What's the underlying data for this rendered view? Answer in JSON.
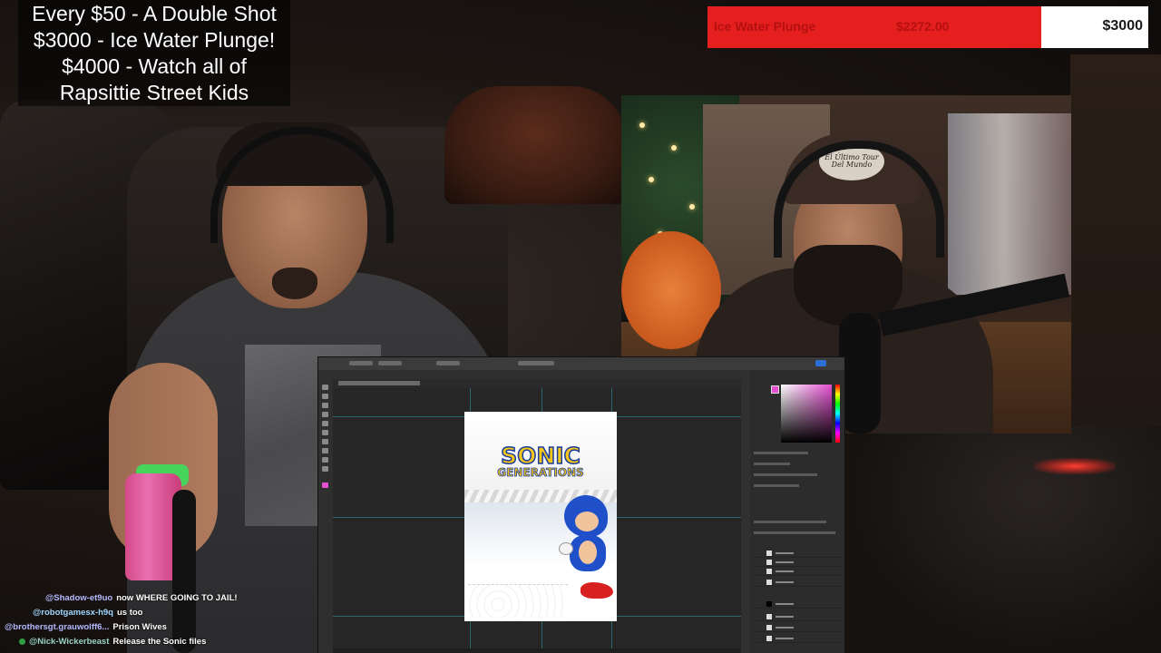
{
  "overlay": {
    "goals": [
      "Every $50 - A Double Shot",
      "$3000 - Ice Water Plunge!",
      "$4000 - Watch all of",
      "Rapsittie Street Kids"
    ]
  },
  "donation_bar": {
    "goal_name": "Ice Water Plunge",
    "current": "$2272.00",
    "target": "$3000",
    "progress_fraction": 0.757,
    "fill_color": "#e51e1e"
  },
  "webcam": {
    "cap_text": "El Último Tour Del Mundo"
  },
  "photoshop": {
    "canvas_logo_line1": "SONIC",
    "canvas_logo_line2": "GENERATIONS",
    "foreground_color": "#e64fd2",
    "accent_color": "#2a6fd6"
  },
  "chat": [
    {
      "user": "@Shadow-et9uo",
      "message": "now WHERE GOING TO JAIL!",
      "badge": false
    },
    {
      "user": "@robotgamesx-h9q",
      "message": "us too",
      "badge": false
    },
    {
      "user": "@brothersgt.grauwolff6...",
      "message": "Prison Wives",
      "badge": false
    },
    {
      "user": "@Nick-Wickerbeast",
      "message": "Release the Sonic files",
      "badge": true
    }
  ]
}
